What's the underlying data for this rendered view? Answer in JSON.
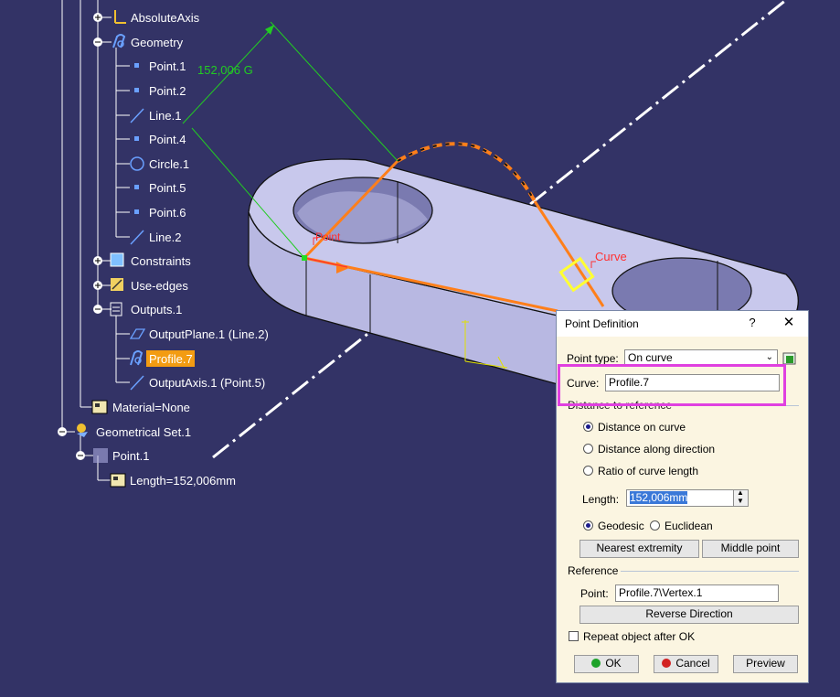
{
  "tree": {
    "items": [
      {
        "label": "AbsoluteAxis"
      },
      {
        "label": "Geometry"
      },
      {
        "label": "Point.1"
      },
      {
        "label": "Point.2"
      },
      {
        "label": "Line.1"
      },
      {
        "label": "Point.4"
      },
      {
        "label": "Circle.1"
      },
      {
        "label": "Point.5"
      },
      {
        "label": "Point.6"
      },
      {
        "label": "Line.2"
      },
      {
        "label": "Constraints"
      },
      {
        "label": "Use-edges"
      },
      {
        "label": "Outputs.1"
      },
      {
        "label": "OutputPlane.1 (Line.2)"
      },
      {
        "label": "Profile.7"
      },
      {
        "label": "OutputAxis.1 (Point.5)"
      },
      {
        "label": "Material=None"
      },
      {
        "label": "Geometrical Set.1"
      },
      {
        "label": "Point.1"
      },
      {
        "label": "Length=152,006mm"
      }
    ]
  },
  "viewport": {
    "dimension_label": "152,006 G",
    "point_label": "Point",
    "curve_label": "Curve"
  },
  "dialog": {
    "title": "Point Definition",
    "help_label": "?",
    "close_label": "✕",
    "point_type_label": "Point type:",
    "point_type_value": "On curve",
    "curve_label": "Curve:",
    "curve_value": "Profile.7",
    "distance_section_label": "Distance to reference",
    "radio_distance_on_curve": "Distance on curve",
    "radio_distance_along_direction": "Distance along direction",
    "radio_ratio": "Ratio of curve length",
    "length_label": "Length:",
    "length_value": "152,006mm",
    "geodesic_label": "Geodesic",
    "euclidean_label": "Euclidean",
    "nearest_extremity_label": "Nearest extremity",
    "middle_point_label": "Middle point",
    "reference_section_label": "Reference",
    "reference_point_label": "Point:",
    "reference_point_value": "Profile.7\\Vertex.1",
    "reverse_direction_label": "Reverse Direction",
    "repeat_label": "Repeat object after OK",
    "ok_label": "OK",
    "cancel_label": "Cancel",
    "preview_label": "Preview"
  },
  "colors": {
    "background": "#333366",
    "part_face": "#c8c8ec",
    "profile_orange": "#ff7f1a",
    "dimension_green": "#22cc22",
    "highlight_magenta": "#e040e0",
    "tree_selected": "#f39c12",
    "ok_green": "#1fa32a",
    "cancel_red": "#d22222"
  }
}
